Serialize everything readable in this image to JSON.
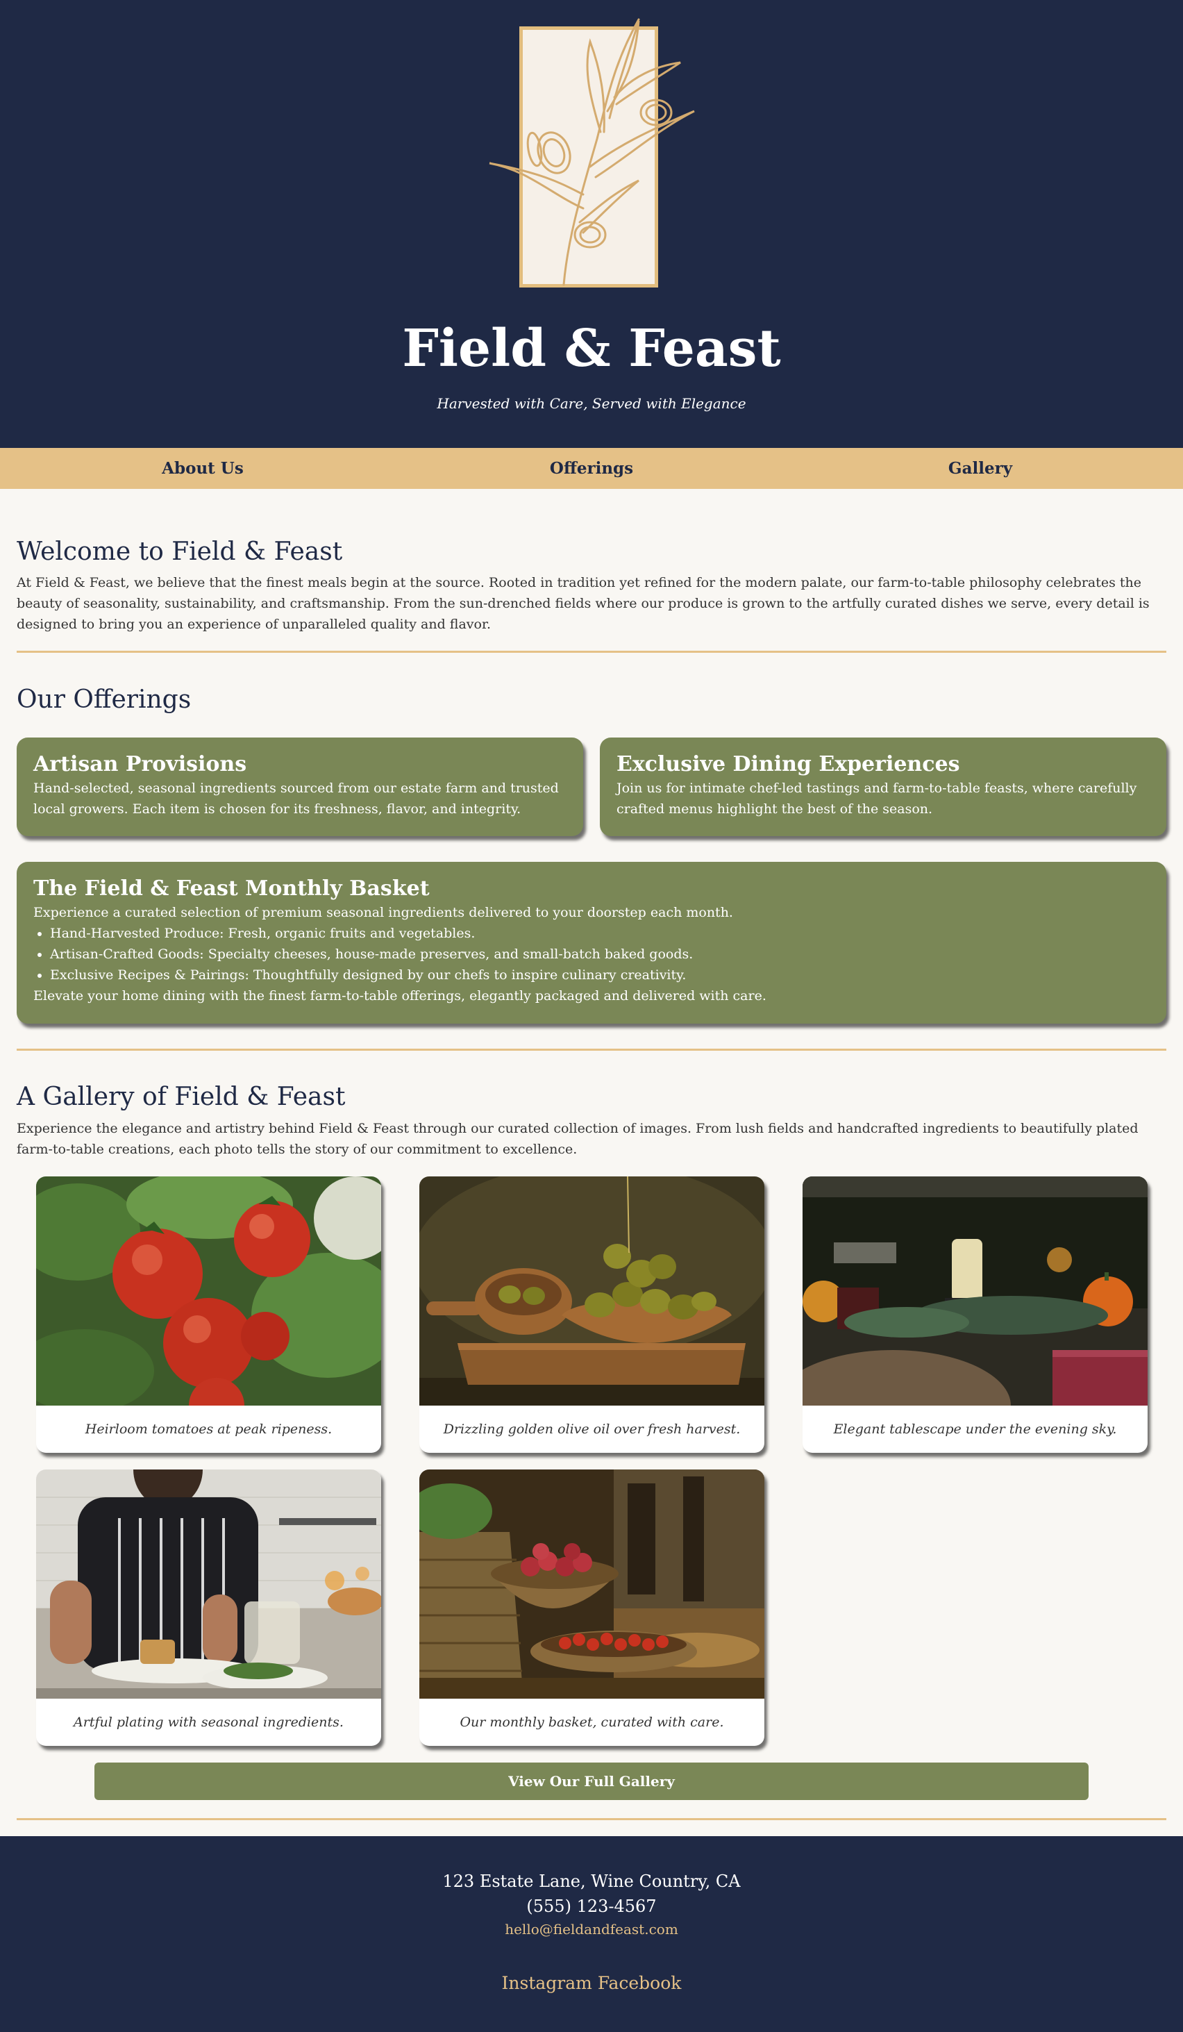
{
  "colors": {
    "navy": "#1f2945",
    "gold": "#e5c187",
    "olive": "#7a8756",
    "cream": "#f9f7f3"
  },
  "header": {
    "logo_icon": "olive-branch-icon",
    "title": "Field & Feast",
    "tagline": "Harvested with Care, Served with Elegance"
  },
  "nav": {
    "items": [
      {
        "label": "About Us"
      },
      {
        "label": "Offerings"
      },
      {
        "label": "Gallery"
      }
    ]
  },
  "welcome": {
    "heading": "Welcome to Field & Feast",
    "text": "At Field & Feast, we believe that the finest meals begin at the source. Rooted in tradition yet refined for the modern palate, our farm-to-table philosophy celebrates the beauty of seasonality, sustainability, and craftsmanship. From the sun-drenched fields where our produce is grown to the artfully curated dishes we serve, every detail is designed to bring you an experience of unparalleled quality and flavor."
  },
  "offerings": {
    "heading": "Our Offerings",
    "cards": [
      {
        "title": "Artisan Provisions",
        "text": "Hand-selected, seasonal ingredients sourced from our estate farm and trusted local growers. Each item is chosen for its freshness, flavor, and integrity."
      },
      {
        "title": "Exclusive Dining Experiences",
        "text": "Join us for intimate chef-led tastings and farm-to-table feasts, where carefully crafted menus highlight the best of the season."
      }
    ],
    "basket": {
      "title": "The Field & Feast Monthly Basket",
      "intro": "Experience a curated selection of premium seasonal ingredients delivered to your doorstep each month.",
      "items": [
        "Hand-Harvested Produce: Fresh, organic fruits and vegetables.",
        "Artisan-Crafted Goods: Specialty cheeses, house-made preserves, and small-batch baked goods.",
        "Exclusive Recipes & Pairings: Thoughtfully designed by our chefs to inspire culinary creativity."
      ],
      "outro": "Elevate your home dining with the finest farm-to-table offerings, elegantly packaged and delivered with care."
    }
  },
  "gallery": {
    "heading": "A Gallery of Field & Feast",
    "text": "Experience the elegance and artistry behind Field & Feast through our curated collection of images. From lush fields and handcrafted ingredients to beautifully plated farm-to-table creations, each photo tells the story of our commitment to excellence.",
    "photos": [
      {
        "caption": "Heirloom tomatoes at peak ripeness."
      },
      {
        "caption": "Drizzling golden olive oil over fresh harvest."
      },
      {
        "caption": "Elegant tablescape under the evening sky."
      },
      {
        "caption": "Artful plating with seasonal ingredients."
      },
      {
        "caption": "Our monthly basket, curated with care."
      }
    ],
    "button": "View Our Full Gallery"
  },
  "footer": {
    "address": "123 Estate Lane, Wine Country, CA",
    "phone": "(555) 123-4567",
    "email": "hello@fieldandfeast.com",
    "social": [
      "Instagram",
      "Facebook"
    ]
  }
}
